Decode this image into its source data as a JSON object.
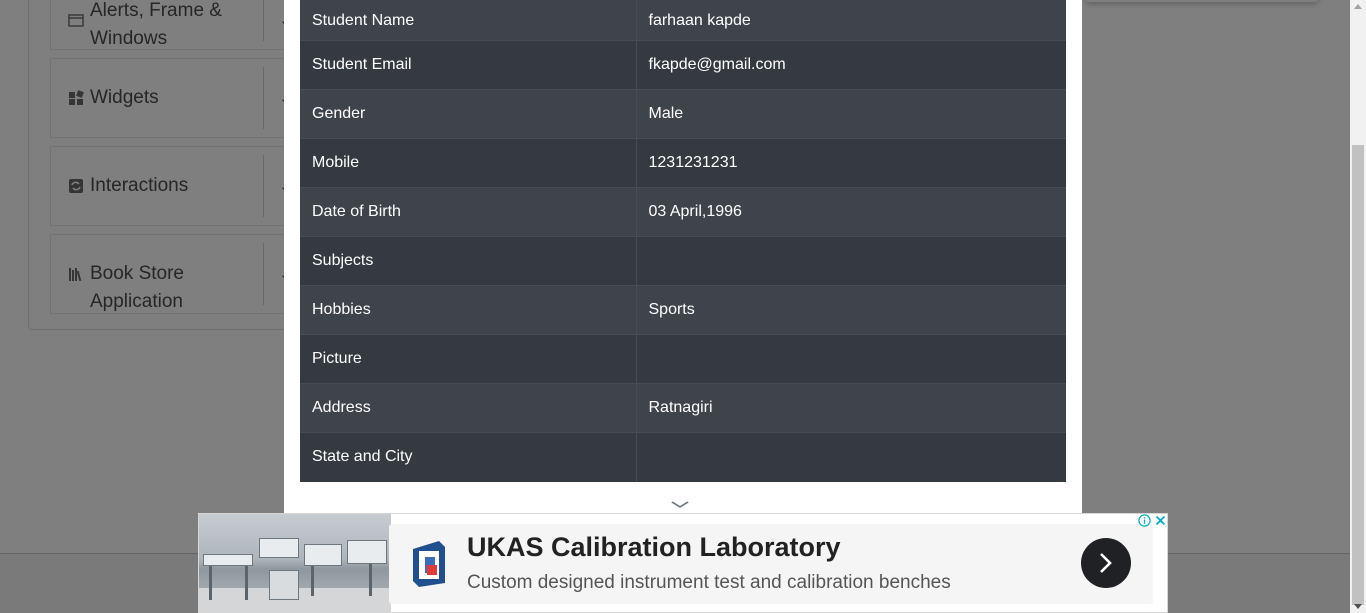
{
  "sidebar": {
    "groups": [
      {
        "label_line1": "Alerts, Frame &",
        "label_line2": "Windows",
        "icon": "window-icon"
      },
      {
        "label_line1": "Widgets",
        "label_line2": "",
        "icon": "widgets-icon"
      },
      {
        "label_line1": "Interactions",
        "label_line2": "",
        "icon": "interactions-icon"
      },
      {
        "label_line1": "Book Store",
        "label_line2": "Application",
        "icon": "books-icon"
      }
    ]
  },
  "modal": {
    "rows": [
      {
        "label": "Student Name",
        "value": "farhaan kapde"
      },
      {
        "label": "Student Email",
        "value": "fkapde@gmail.com"
      },
      {
        "label": "Gender",
        "value": "Male"
      },
      {
        "label": "Mobile",
        "value": "1231231231"
      },
      {
        "label": "Date of Birth",
        "value": "03 April,1996"
      },
      {
        "label": "Subjects",
        "value": ""
      },
      {
        "label": "Hobbies",
        "value": "Sports"
      },
      {
        "label": "Picture",
        "value": ""
      },
      {
        "label": "Address",
        "value": "Ratnagiri"
      },
      {
        "label": "State and City",
        "value": ""
      }
    ],
    "chevron_icon": "chevron-down-icon"
  },
  "ad": {
    "title": "UKAS Calibration Laboratory",
    "subtitle": "Custom designed instrument test and calibration benches",
    "go_icon": "chevron-right-icon",
    "info_icon": "info-icon",
    "close_icon": "close-icon"
  },
  "colors": {
    "table_row_odd": "#3f434a",
    "table_row_even": "#343a40",
    "ad_accent": "#00aecd",
    "overlay": "rgba(0,0,0,0.5)"
  }
}
